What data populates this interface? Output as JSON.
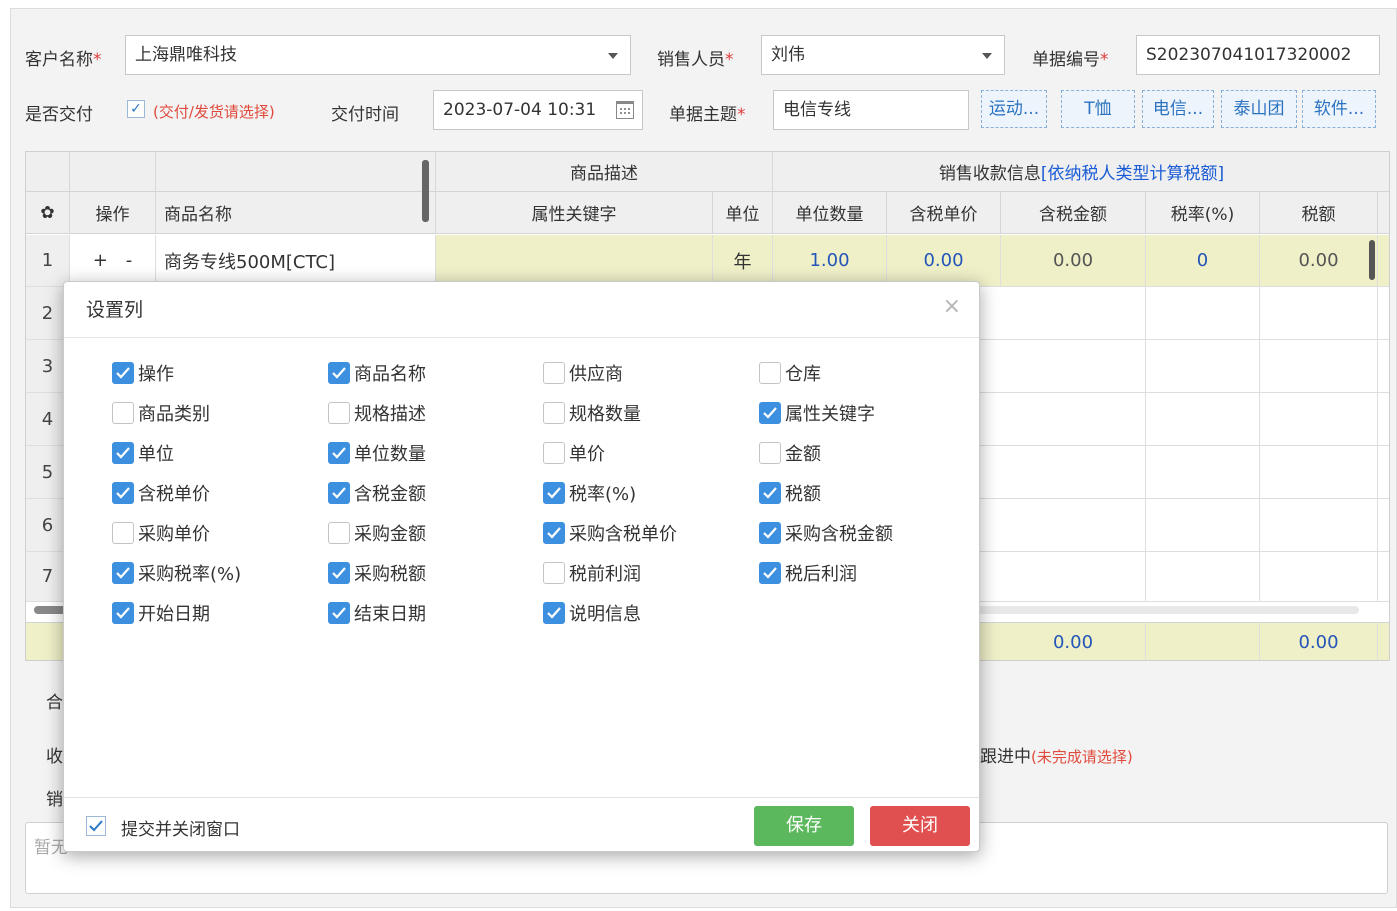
{
  "form": {
    "customer_label": "客户名称",
    "customer_value": "上海鼎唯科技",
    "sales_label": "销售人员",
    "sales_value": "刘伟",
    "docno_label": "单据编号",
    "docno_value": "S202307041017320002",
    "deliver_label": "是否交付",
    "deliver_checked": true,
    "deliver_hint": "(交付/发货请选择)",
    "deliver_time_label": "交付时间",
    "deliver_time_value": "2023-07-04 10:31",
    "subject_label": "单据主题",
    "subject_value": "电信专线",
    "required_mark": "*",
    "tags": [
      "运动...",
      "T恤",
      "电信...",
      "泰山团",
      "软件..."
    ]
  },
  "grid": {
    "group_headers": {
      "product_desc": "商品描述",
      "sales_info_prefix": "销售收款信息",
      "sales_info_link": "[依纳税人类型计算税额]"
    },
    "columns": {
      "op": "操作",
      "name": "商品名称",
      "attr": "属性关键字",
      "unit": "单位",
      "qty": "单位数量",
      "price": "含税单价",
      "amount": "含税金额",
      "taxrate": "税率(%)",
      "tax": "税额"
    },
    "row1": {
      "num": "1",
      "op_plus": "+",
      "op_minus": "-",
      "name": "商务专线500M[CTC]",
      "unit": "年",
      "qty": "1.00",
      "price": "0.00",
      "amount": "0.00",
      "taxrate": "0",
      "tax": "0.00"
    },
    "row_numbers": [
      "2",
      "3",
      "4",
      "5",
      "6",
      "7"
    ],
    "footer": {
      "amount": "0.00",
      "tax": "0.00"
    }
  },
  "below": {
    "label_he": "合",
    "label_shou": "收",
    "label_xiao": "销",
    "progress_prefix": "跟进中",
    "progress_hint": "(未完成请选择)",
    "notes_placeholder": "暂无"
  },
  "modal": {
    "title": "设置列",
    "close_glyph": "×",
    "options": [
      {
        "label": "操作",
        "checked": true
      },
      {
        "label": "商品名称",
        "checked": true
      },
      {
        "label": "供应商",
        "checked": false
      },
      {
        "label": "仓库",
        "checked": false
      },
      {
        "label": "商品类别",
        "checked": false
      },
      {
        "label": "规格描述",
        "checked": false
      },
      {
        "label": "规格数量",
        "checked": false
      },
      {
        "label": "属性关键字",
        "checked": true
      },
      {
        "label": "单位",
        "checked": true
      },
      {
        "label": "单位数量",
        "checked": true
      },
      {
        "label": "单价",
        "checked": false
      },
      {
        "label": "金额",
        "checked": false
      },
      {
        "label": "含税单价",
        "checked": true
      },
      {
        "label": "含税金额",
        "checked": true
      },
      {
        "label": "税率(%)",
        "checked": true
      },
      {
        "label": "税额",
        "checked": true
      },
      {
        "label": "采购单价",
        "checked": false
      },
      {
        "label": "采购金额",
        "checked": false
      },
      {
        "label": "采购含税单价",
        "checked": true
      },
      {
        "label": "采购含税金额",
        "checked": true
      },
      {
        "label": "采购税率(%)",
        "checked": true
      },
      {
        "label": "采购税额",
        "checked": true
      },
      {
        "label": "税前利润",
        "checked": false
      },
      {
        "label": "税后利润",
        "checked": true
      },
      {
        "label": "开始日期",
        "checked": true
      },
      {
        "label": "结束日期",
        "checked": true
      },
      {
        "label": "说明信息",
        "checked": true
      }
    ],
    "submit_close_label": "提交并关闭窗口",
    "submit_close_checked": true,
    "save_label": "保存",
    "close_label": "关闭"
  },
  "colors": {
    "accent": "#3d8fe0",
    "save": "#5cb85c",
    "close": "#e05050",
    "required": "#e23b3b",
    "row_highlight": "#efefc8"
  }
}
